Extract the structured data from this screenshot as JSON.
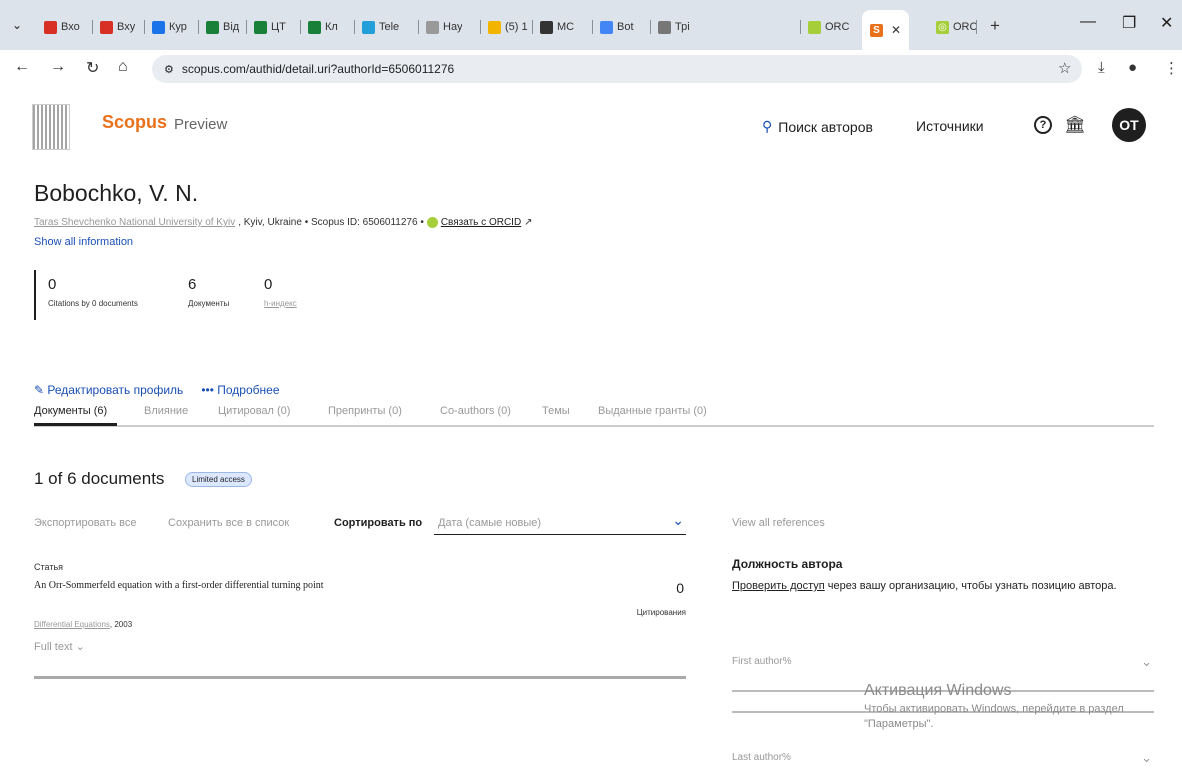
{
  "browser": {
    "tabs": [
      {
        "label": "Вхо",
        "favicon": "gmail-icon",
        "color": "#d93025"
      },
      {
        "label": "Вху",
        "favicon": "gmail-icon",
        "color": "#d93025"
      },
      {
        "label": "Кур",
        "favicon": "drive-icon",
        "color": "#1a73e8"
      },
      {
        "label": "Від",
        "favicon": "sheets-icon",
        "color": "#188038"
      },
      {
        "label": "ЦТ",
        "favicon": "sheets-icon",
        "color": "#188038"
      },
      {
        "label": "Кл",
        "favicon": "sheets-icon",
        "color": "#188038"
      },
      {
        "label": "Tele",
        "favicon": "telegram-icon",
        "color": "#229ed9"
      },
      {
        "label": "Нау",
        "favicon": "wiki-icon",
        "color": "#999999"
      },
      {
        "label": "(5) 1",
        "favicon": "bar-icon",
        "color": "#f2b400"
      },
      {
        "label": "МС",
        "favicon": "mc-icon",
        "color": "#333333"
      },
      {
        "label": "Bot",
        "favicon": "google-icon",
        "color": "#4285f4"
      },
      {
        "label": "Трі",
        "favicon": "line-icon",
        "color": "#777777"
      },
      {
        "label": "ORC",
        "favicon": "orcid-icon",
        "color": "#a6ce39"
      }
    ],
    "active_tab": {
      "label": "",
      "favicon": "scopus-icon",
      "color": "#e9711c"
    },
    "last_tab": {
      "label": "ORC",
      "favicon": "orcid-icon",
      "color": "#a6ce39"
    },
    "url": "scopus.com/authid/detail.uri?authorId=6506011276"
  },
  "header": {
    "brand": "Scopus",
    "brand_sub": "Preview",
    "search_authors": "Поиск авторов",
    "sources": "Источники",
    "help_icon": "?",
    "avatar_initials": "OT"
  },
  "author": {
    "name": "Bobochko, V. N.",
    "affiliation": "Taras Shevchenko National University of Kyiv",
    "location": ", Kyiv, Ukraine • Scopus ID: 6506011276 •",
    "orcid_link": "Связать с ORCID",
    "show_all": "Show all information"
  },
  "metrics": [
    {
      "value": "0",
      "label": "Citations by 0 documents"
    },
    {
      "value": "6",
      "label": "Документы"
    },
    {
      "value": "0",
      "label": "h-индекс"
    }
  ],
  "actions": {
    "edit_profile": "Редактировать профиль",
    "more": "Подробнее"
  },
  "subtabs": [
    "Документы (6)",
    "Влияние",
    "Цитировал (0)",
    "Препринты (0)",
    "Co-authors (0)",
    "Темы",
    "Выданные гранты (0)"
  ],
  "documents": {
    "heading": "1 of 6 documents",
    "badge": "Limited access",
    "export_all": "Экспортировать все",
    "save_all": "Сохранить все в список",
    "sort_label": "Сортировать по",
    "sort_value": "Дата (самые новые)",
    "items": [
      {
        "type": "Статья",
        "title": "An Orr-Sommerfeld equation with a first-order differential turning point",
        "citations": "0",
        "citations_label": "Цитирования",
        "source": "Differential Equations",
        "year": ", 2003",
        "full_text": "Full text"
      }
    ]
  },
  "right_panel": {
    "view_refs": "View all references",
    "position_title": "Должность автора",
    "check_access": "Проверить доступ",
    "position_text": " через вашу организацию, чтобы узнать позицию автора.",
    "first_author": "First author%",
    "last_author": "Last author%"
  },
  "watermark": {
    "title": "Активация Windows",
    "text": "Чтобы активировать Windows, перейдите в раздел \"Параметры\"."
  }
}
